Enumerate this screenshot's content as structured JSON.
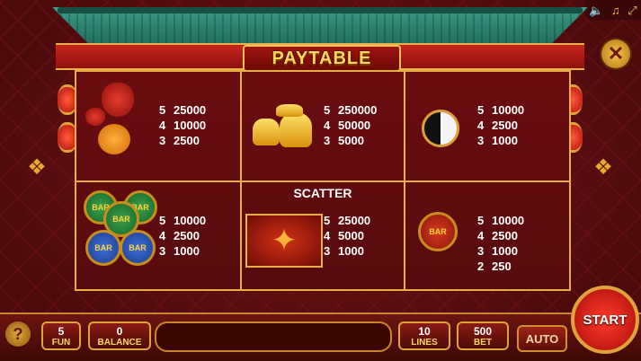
{
  "title": "PAYTABLE",
  "top_icons": [
    "speaker-icon",
    "music-note-icon",
    "fullscreen-icon"
  ],
  "close_label": "✕",
  "cells": [
    {
      "symbol": "lucky-bag-and-gourd",
      "pays": [
        [
          "5",
          "25000"
        ],
        [
          "4",
          "10000"
        ],
        [
          "3",
          "2500"
        ]
      ]
    },
    {
      "symbol": "gold-ingots",
      "pays": [
        [
          "5",
          "250000"
        ],
        [
          "4",
          "50000"
        ],
        [
          "3",
          "5000"
        ]
      ]
    },
    {
      "symbol": "yin-yang-amulet",
      "pays": [
        [
          "5",
          "10000"
        ],
        [
          "4",
          "2500"
        ],
        [
          "3",
          "1000"
        ]
      ]
    },
    {
      "symbol": "bar-coins",
      "pays": [
        [
          "5",
          "10000"
        ],
        [
          "4",
          "2500"
        ],
        [
          "3",
          "1000"
        ]
      ]
    },
    {
      "symbol": "phoenix",
      "label": "SCATTER",
      "pays": [
        [
          "5",
          "25000"
        ],
        [
          "4",
          "5000"
        ],
        [
          "3",
          "1000"
        ]
      ]
    },
    {
      "symbol": "red-bar-coin",
      "pays": [
        [
          "5",
          "10000"
        ],
        [
          "4",
          "2500"
        ],
        [
          "3",
          "1000"
        ],
        [
          "2",
          "250"
        ]
      ]
    }
  ],
  "coin_text": "BAR",
  "bottom": {
    "help": "?",
    "fun": {
      "value": "5",
      "label": "FUN"
    },
    "balance": {
      "value": "0",
      "label": "BALANCE"
    },
    "lines": {
      "value": "10",
      "label": "LINES"
    },
    "bet": {
      "value": "500",
      "label": "BET"
    },
    "auto": "AUTO",
    "start": "START"
  },
  "colors": {
    "gold": "#e7ae43",
    "panel": "#6a0d10",
    "roof": "#2f8a76"
  }
}
